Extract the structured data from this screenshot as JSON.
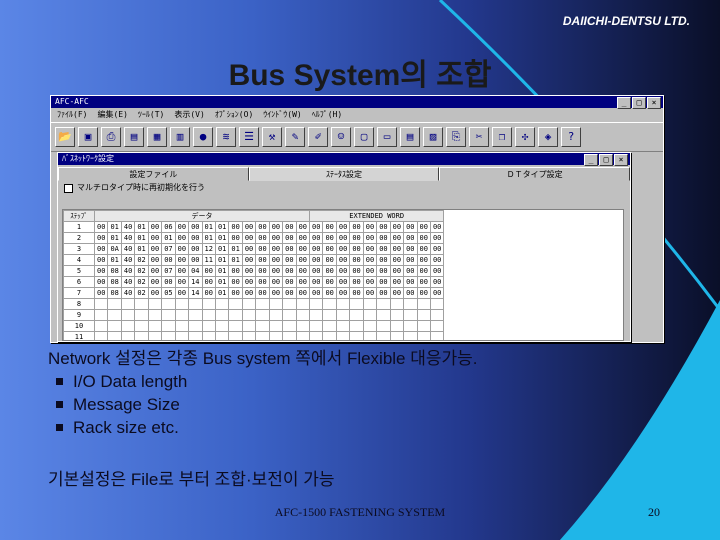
{
  "brand": "DAIICHI-DENTSU LTD.",
  "title": "Bus System의 조합",
  "app": {
    "window_title": "AFC-AFC",
    "menu": [
      "ﾌｧｲﾙ(F)",
      "編集(E)",
      "ﾂｰﾙ(T)",
      "表示(V)",
      "ｵﾌﾟｼｮﾝ(O)",
      "ｳｲﾝﾄﾞｳ(W)",
      "ﾍﾙﾌﾟ(H)"
    ],
    "toolbar_icons": [
      "open-folder-icon",
      "save-icon",
      "print-icon",
      "preview-icon",
      "table-icon",
      "grid-icon",
      "stop-icon",
      "signal-icon",
      "list-icon",
      "tool-icon",
      "edit-icon",
      "pen-icon",
      "user-icon",
      "window-icon",
      "monitor-icon",
      "calc-icon",
      "chart-icon",
      "paste-icon",
      "cut-icon",
      "copy-icon",
      "network-icon",
      "device-icon",
      "help-icon"
    ],
    "child": {
      "title": "ﾊﾞｽﾈｯﾄﾜｰｸ設定",
      "tabs": [
        "設定ファイル",
        "ｽﾃｰﾀｽ設定",
        "ＤＴタイプ設定"
      ],
      "option": "マルチロタイプ時に再初期化を行う",
      "grid": {
        "col_step": "ｽﾃｯﾌﾟ",
        "col_data": "データ",
        "col_ext": "EXTENDED WORD",
        "rows": [
          {
            "step": "1",
            "cells": [
              "00",
              "01",
              "40",
              "01",
              "00",
              "06",
              "00",
              "00",
              "01",
              "01",
              "00",
              "00",
              "00",
              "00",
              "00",
              "00",
              "00",
              "00",
              "00",
              "00",
              "00",
              "00",
              "00",
              "00",
              "00",
              "00"
            ]
          },
          {
            "step": "2",
            "cells": [
              "00",
              "01",
              "40",
              "01",
              "00",
              "01",
              "00",
              "00",
              "01",
              "01",
              "00",
              "00",
              "00",
              "00",
              "00",
              "00",
              "00",
              "00",
              "00",
              "00",
              "00",
              "00",
              "00",
              "00",
              "00",
              "00"
            ]
          },
          {
            "step": "3",
            "cells": [
              "00",
              "0A",
              "40",
              "01",
              "00",
              "07",
              "00",
              "00",
              "12",
              "01",
              "01",
              "00",
              "00",
              "00",
              "00",
              "00",
              "00",
              "00",
              "00",
              "00",
              "00",
              "00",
              "00",
              "00",
              "00",
              "00"
            ]
          },
          {
            "step": "4",
            "cells": [
              "00",
              "01",
              "40",
              "02",
              "00",
              "00",
              "00",
              "00",
              "11",
              "01",
              "01",
              "00",
              "00",
              "00",
              "00",
              "00",
              "00",
              "00",
              "00",
              "00",
              "00",
              "00",
              "00",
              "00",
              "00",
              "00"
            ]
          },
          {
            "step": "5",
            "cells": [
              "00",
              "08",
              "40",
              "02",
              "00",
              "07",
              "00",
              "04",
              "00",
              "01",
              "00",
              "00",
              "00",
              "00",
              "00",
              "00",
              "00",
              "00",
              "00",
              "00",
              "00",
              "00",
              "00",
              "00",
              "00",
              "00"
            ]
          },
          {
            "step": "6",
            "cells": [
              "00",
              "08",
              "40",
              "02",
              "00",
              "00",
              "00",
              "14",
              "00",
              "01",
              "00",
              "00",
              "00",
              "00",
              "00",
              "00",
              "00",
              "00",
              "00",
              "00",
              "00",
              "00",
              "00",
              "00",
              "00",
              "00"
            ]
          },
          {
            "step": "7",
            "cells": [
              "00",
              "08",
              "40",
              "02",
              "00",
              "05",
              "00",
              "14",
              "00",
              "01",
              "00",
              "00",
              "00",
              "00",
              "00",
              "00",
              "00",
              "00",
              "00",
              "00",
              "00",
              "00",
              "00",
              "00",
              "00",
              "00"
            ]
          },
          {
            "step": "8",
            "cells": [
              "",
              "",
              "",
              "",
              "",
              "",
              "",
              "",
              "",
              "",
              "",
              "",
              "",
              "",
              "",
              "",
              "",
              "",
              "",
              "",
              "",
              "",
              "",
              "",
              "",
              ""
            ]
          },
          {
            "step": "9",
            "cells": [
              "",
              "",
              "",
              "",
              "",
              "",
              "",
              "",
              "",
              "",
              "",
              "",
              "",
              "",
              "",
              "",
              "",
              "",
              "",
              "",
              "",
              "",
              "",
              "",
              "",
              ""
            ]
          },
          {
            "step": "10",
            "cells": [
              "",
              "",
              "",
              "",
              "",
              "",
              "",
              "",
              "",
              "",
              "",
              "",
              "",
              "",
              "",
              "",
              "",
              "",
              "",
              "",
              "",
              "",
              "",
              "",
              "",
              ""
            ]
          },
          {
            "step": "11",
            "cells": [
              "",
              "",
              "",
              "",
              "",
              "",
              "",
              "",
              "",
              "",
              "",
              "",
              "",
              "",
              "",
              "",
              "",
              "",
              "",
              "",
              "",
              "",
              "",
              "",
              "",
              ""
            ]
          }
        ]
      }
    }
  },
  "body": {
    "intro": "Network 설정은 각종 Bus system 쪽에서 Flexible 대응가능.",
    "bullets": [
      "I/O Data length",
      "Message Size",
      "Rack size   etc."
    ],
    "note": "기본설정은 File로 부터 조합·보전이 가능"
  },
  "footer": "AFC-1500 FASTENING SYSTEM",
  "page_number": "20",
  "colors": {
    "accent_cyan": "#1fb6e8",
    "title_bar": "#000080"
  }
}
